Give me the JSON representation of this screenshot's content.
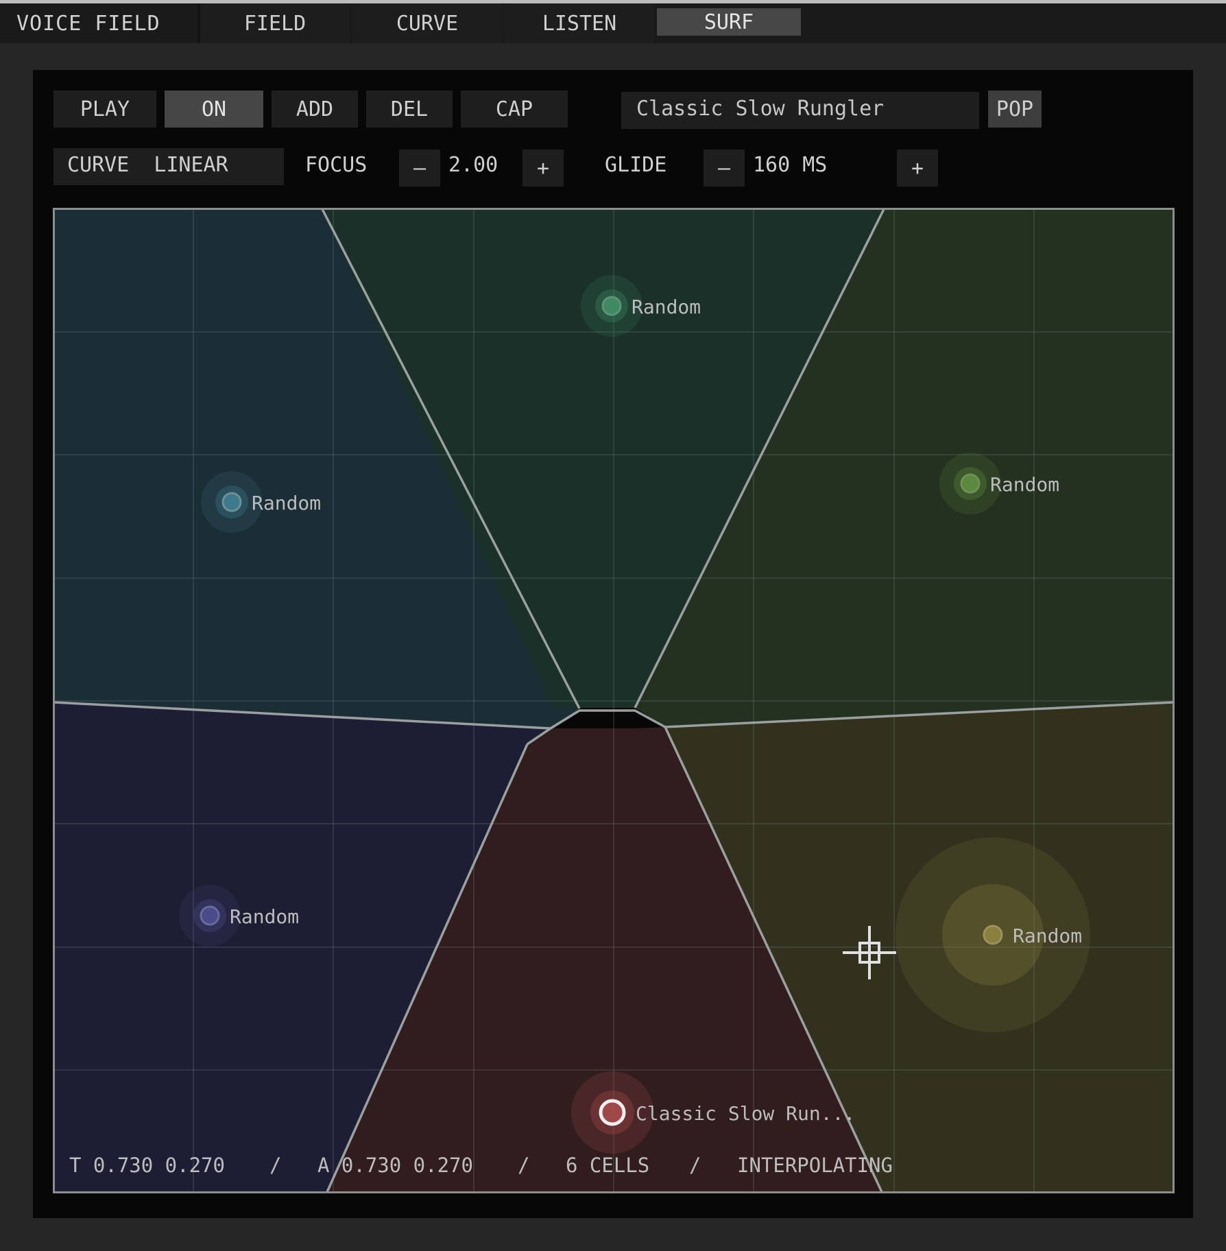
{
  "app": {
    "title": "VOICE FIELD"
  },
  "tabs": [
    {
      "label": "FIELD",
      "active": false
    },
    {
      "label": "CURVE",
      "active": false
    },
    {
      "label": "LISTEN",
      "active": false
    },
    {
      "label": "SURF",
      "active": true
    }
  ],
  "toolbar": {
    "play": "PLAY",
    "on": "ON",
    "add": "ADD",
    "del": "DEL",
    "cap": "CAP",
    "preset_name": "Classic Slow Rungler",
    "pop": "POP"
  },
  "controls": {
    "curve_label": "CURVE",
    "curve_value": "LINEAR",
    "focus_label": "FOCUS",
    "focus_minus": "–",
    "focus_value": "2.00",
    "focus_plus": "+",
    "glide_label": "GLIDE",
    "glide_minus": "–",
    "glide_value": "160 MS",
    "glide_plus": "+"
  },
  "field": {
    "cells": [
      {
        "label": "Random",
        "color": "#1b2d35",
        "dot": "#3d7a8c"
      },
      {
        "label": "Random",
        "color": "#1a3029",
        "dot": "#3f8a62"
      },
      {
        "label": "Random",
        "color": "#243120",
        "dot": "#5c8a3c"
      },
      {
        "label": "Random",
        "color": "#1d1e33",
        "dot": "#4b4a8a"
      },
      {
        "label": "Classic Slow Run...",
        "color": "#311d1e",
        "dot": "#a04848",
        "selected": true
      },
      {
        "label": "Random",
        "color": "#32311e",
        "dot": "#8a803e",
        "active": true
      }
    ],
    "status": {
      "t": "T 0.730 0.270",
      "sep1": "/",
      "a": "A 0.730 0.270",
      "sep2": "/",
      "cells": "6 CELLS",
      "sep3": "/",
      "mode": "INTERPOLATING"
    }
  }
}
